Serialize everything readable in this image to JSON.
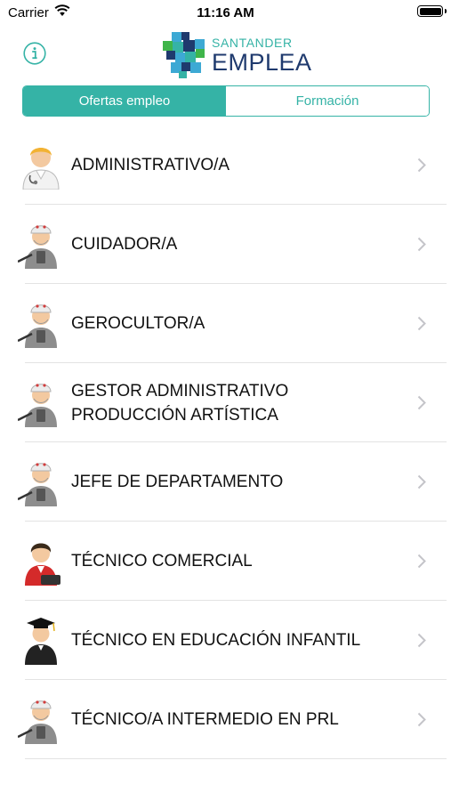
{
  "status_bar": {
    "carrier": "Carrier",
    "time": "11:16 AM"
  },
  "header": {
    "info_icon": "info-icon",
    "logo_top": "SANTANDER",
    "logo_bottom": "EMPLEA"
  },
  "tabs": [
    {
      "label": "Ofertas empleo",
      "selected": true
    },
    {
      "label": "Formación",
      "selected": false
    }
  ],
  "colors": {
    "accent": "#35b3a6",
    "logo_navy": "#1f3a6e",
    "separator": "#e3e3e3"
  },
  "jobs": [
    {
      "title": "ADMINISTRATIVO/A",
      "icon": "doctor-icon"
    },
    {
      "title": "CUIDADOR/A",
      "icon": "worker-icon"
    },
    {
      "title": "GEROCULTOR/A",
      "icon": "worker-icon"
    },
    {
      "title": "GESTOR ADMINISTRATIVO PRODUCCIÓN ARTÍSTICA",
      "icon": "worker-icon"
    },
    {
      "title": "JEFE DE DEPARTAMENTO",
      "icon": "worker-icon"
    },
    {
      "title": "TÉCNICO COMERCIAL",
      "icon": "business-person-icon"
    },
    {
      "title": "TÉCNICO EN EDUCACIÓN INFANTIL",
      "icon": "graduate-icon"
    },
    {
      "title": "TÉCNICO/A INTERMEDIO EN PRL",
      "icon": "worker-icon"
    }
  ]
}
